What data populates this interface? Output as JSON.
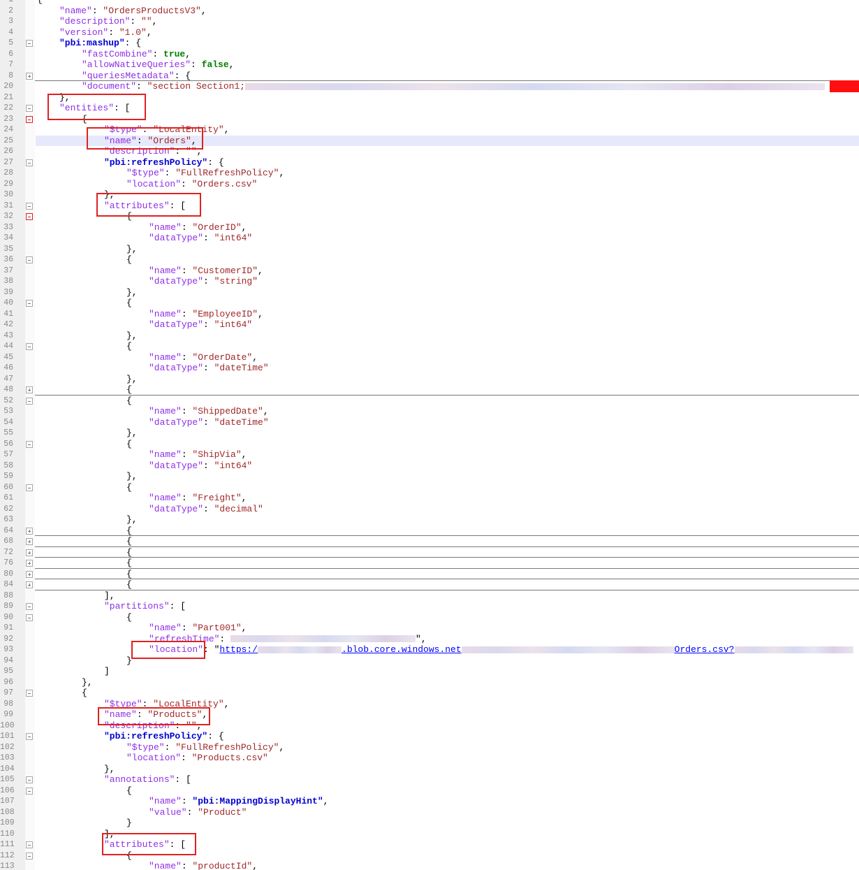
{
  "editor": {
    "lines": [
      {
        "n": "1",
        "d": 0,
        "t": [
          [
            "p",
            "{"
          ]
        ]
      },
      {
        "n": "2",
        "d": 1,
        "t": [
          [
            "k",
            "\"name\""
          ],
          [
            "p",
            ": "
          ],
          [
            "s",
            "\"OrdersProductsV3\""
          ],
          [
            "p",
            ","
          ]
        ]
      },
      {
        "n": "3",
        "d": 1,
        "t": [
          [
            "k",
            "\"description\""
          ],
          [
            "p",
            ": "
          ],
          [
            "s",
            "\"\""
          ],
          [
            "p",
            ","
          ]
        ]
      },
      {
        "n": "4",
        "d": 1,
        "t": [
          [
            "k",
            "\"version\""
          ],
          [
            "p",
            ": "
          ],
          [
            "s",
            "\"1.0\""
          ],
          [
            "p",
            ","
          ]
        ]
      },
      {
        "n": "5",
        "d": 1,
        "t": [
          [
            "b",
            "\"pbi:mashup\""
          ],
          [
            "p",
            ": {"
          ]
        ]
      },
      {
        "n": "6",
        "d": 2,
        "t": [
          [
            "k",
            "\"fastCombine\""
          ],
          [
            "p",
            ": "
          ],
          [
            "g",
            "true"
          ],
          [
            "p",
            ","
          ]
        ]
      },
      {
        "n": "7",
        "d": 2,
        "t": [
          [
            "k",
            "\"allowNativeQueries\""
          ],
          [
            "p",
            ": "
          ],
          [
            "g",
            "false"
          ],
          [
            "p",
            ","
          ]
        ]
      },
      {
        "n": "8",
        "d": 2,
        "t": [
          [
            "k",
            "\"queriesMetadata\""
          ],
          [
            "p",
            ": {"
          ]
        ]
      },
      {
        "n": "20",
        "d": 2,
        "t": [
          [
            "k",
            "\"document\""
          ],
          [
            "p",
            ": "
          ],
          [
            "s",
            "\"section Section1;"
          ],
          [
            "blur",
            "830"
          ]
        ]
      },
      {
        "n": "21",
        "d": 1,
        "t": [
          [
            "p",
            "},"
          ]
        ]
      },
      {
        "n": "22",
        "d": 1,
        "t": [
          [
            "k",
            "\"entities\""
          ],
          [
            "p",
            ": ["
          ]
        ]
      },
      {
        "n": "23",
        "d": 2,
        "t": [
          [
            "p",
            "{"
          ]
        ]
      },
      {
        "n": "24",
        "d": 3,
        "t": [
          [
            "k",
            "\"$type\""
          ],
          [
            "p",
            ": "
          ],
          [
            "s",
            "\"LocalEntity\""
          ],
          [
            "p",
            ","
          ]
        ]
      },
      {
        "n": "25",
        "d": 3,
        "t": [
          [
            "k",
            "\"name\""
          ],
          [
            "p",
            ": "
          ],
          [
            "s",
            "\"Orders\""
          ],
          [
            "p",
            ","
          ]
        ]
      },
      {
        "n": "26",
        "d": 3,
        "t": [
          [
            "k",
            "\"description\""
          ],
          [
            "p",
            ": "
          ],
          [
            "s",
            "\"\""
          ],
          [
            "p",
            ","
          ]
        ]
      },
      {
        "n": "27",
        "d": 3,
        "t": [
          [
            "b",
            "\"pbi:refreshPolicy\""
          ],
          [
            "p",
            ": {"
          ]
        ]
      },
      {
        "n": "28",
        "d": 4,
        "t": [
          [
            "k",
            "\"$type\""
          ],
          [
            "p",
            ": "
          ],
          [
            "s",
            "\"FullRefreshPolicy\""
          ],
          [
            "p",
            ","
          ]
        ]
      },
      {
        "n": "29",
        "d": 4,
        "t": [
          [
            "k",
            "\"location\""
          ],
          [
            "p",
            ": "
          ],
          [
            "s",
            "\"Orders.csv\""
          ]
        ]
      },
      {
        "n": "30",
        "d": 3,
        "t": [
          [
            "p",
            "},"
          ]
        ]
      },
      {
        "n": "31",
        "d": 3,
        "t": [
          [
            "k",
            "\"attributes\""
          ],
          [
            "p",
            ": ["
          ]
        ]
      },
      {
        "n": "32",
        "d": 4,
        "t": [
          [
            "p",
            "{"
          ]
        ]
      },
      {
        "n": "33",
        "d": 5,
        "t": [
          [
            "k",
            "\"name\""
          ],
          [
            "p",
            ": "
          ],
          [
            "s",
            "\"OrderID\""
          ],
          [
            "p",
            ","
          ]
        ]
      },
      {
        "n": "34",
        "d": 5,
        "t": [
          [
            "k",
            "\"dataType\""
          ],
          [
            "p",
            ": "
          ],
          [
            "s",
            "\"int64\""
          ]
        ]
      },
      {
        "n": "35",
        "d": 4,
        "t": [
          [
            "p",
            "},"
          ]
        ]
      },
      {
        "n": "36",
        "d": 4,
        "t": [
          [
            "p",
            "{"
          ]
        ]
      },
      {
        "n": "37",
        "d": 5,
        "t": [
          [
            "k",
            "\"name\""
          ],
          [
            "p",
            ": "
          ],
          [
            "s",
            "\"CustomerID\""
          ],
          [
            "p",
            ","
          ]
        ]
      },
      {
        "n": "38",
        "d": 5,
        "t": [
          [
            "k",
            "\"dataType\""
          ],
          [
            "p",
            ": "
          ],
          [
            "s",
            "\"string\""
          ]
        ]
      },
      {
        "n": "39",
        "d": 4,
        "t": [
          [
            "p",
            "},"
          ]
        ]
      },
      {
        "n": "40",
        "d": 4,
        "t": [
          [
            "p",
            "{"
          ]
        ]
      },
      {
        "n": "41",
        "d": 5,
        "t": [
          [
            "k",
            "\"name\""
          ],
          [
            "p",
            ": "
          ],
          [
            "s",
            "\"EmployeeID\""
          ],
          [
            "p",
            ","
          ]
        ]
      },
      {
        "n": "42",
        "d": 5,
        "t": [
          [
            "k",
            "\"dataType\""
          ],
          [
            "p",
            ": "
          ],
          [
            "s",
            "\"int64\""
          ]
        ]
      },
      {
        "n": "43",
        "d": 4,
        "t": [
          [
            "p",
            "},"
          ]
        ]
      },
      {
        "n": "44",
        "d": 4,
        "t": [
          [
            "p",
            "{"
          ]
        ]
      },
      {
        "n": "45",
        "d": 5,
        "t": [
          [
            "k",
            "\"name\""
          ],
          [
            "p",
            ": "
          ],
          [
            "s",
            "\"OrderDate\""
          ],
          [
            "p",
            ","
          ]
        ]
      },
      {
        "n": "46",
        "d": 5,
        "t": [
          [
            "k",
            "\"dataType\""
          ],
          [
            "p",
            ": "
          ],
          [
            "s",
            "\"dateTime\""
          ]
        ]
      },
      {
        "n": "47",
        "d": 4,
        "t": [
          [
            "p",
            "},"
          ]
        ]
      },
      {
        "n": "48",
        "d": 4,
        "t": [
          [
            "p",
            "{"
          ]
        ]
      },
      {
        "n": "52",
        "d": 4,
        "t": [
          [
            "p",
            "{"
          ]
        ]
      },
      {
        "n": "53",
        "d": 5,
        "t": [
          [
            "k",
            "\"name\""
          ],
          [
            "p",
            ": "
          ],
          [
            "s",
            "\"ShippedDate\""
          ],
          [
            "p",
            ","
          ]
        ]
      },
      {
        "n": "54",
        "d": 5,
        "t": [
          [
            "k",
            "\"dataType\""
          ],
          [
            "p",
            ": "
          ],
          [
            "s",
            "\"dateTime\""
          ]
        ]
      },
      {
        "n": "55",
        "d": 4,
        "t": [
          [
            "p",
            "},"
          ]
        ]
      },
      {
        "n": "56",
        "d": 4,
        "t": [
          [
            "p",
            "{"
          ]
        ]
      },
      {
        "n": "57",
        "d": 5,
        "t": [
          [
            "k",
            "\"name\""
          ],
          [
            "p",
            ": "
          ],
          [
            "s",
            "\"ShipVia\""
          ],
          [
            "p",
            ","
          ]
        ]
      },
      {
        "n": "58",
        "d": 5,
        "t": [
          [
            "k",
            "\"dataType\""
          ],
          [
            "p",
            ": "
          ],
          [
            "s",
            "\"int64\""
          ]
        ]
      },
      {
        "n": "59",
        "d": 4,
        "t": [
          [
            "p",
            "},"
          ]
        ]
      },
      {
        "n": "60",
        "d": 4,
        "t": [
          [
            "p",
            "{"
          ]
        ]
      },
      {
        "n": "61",
        "d": 5,
        "t": [
          [
            "k",
            "\"name\""
          ],
          [
            "p",
            ": "
          ],
          [
            "s",
            "\"Freight\""
          ],
          [
            "p",
            ","
          ]
        ]
      },
      {
        "n": "62",
        "d": 5,
        "t": [
          [
            "k",
            "\"dataType\""
          ],
          [
            "p",
            ": "
          ],
          [
            "s",
            "\"decimal\""
          ]
        ]
      },
      {
        "n": "63",
        "d": 4,
        "t": [
          [
            "p",
            "},"
          ]
        ]
      },
      {
        "n": "64",
        "d": 4,
        "t": [
          [
            "p",
            "{"
          ]
        ]
      },
      {
        "n": "68",
        "d": 4,
        "t": [
          [
            "p",
            "{"
          ]
        ]
      },
      {
        "n": "72",
        "d": 4,
        "t": [
          [
            "p",
            "{"
          ]
        ]
      },
      {
        "n": "76",
        "d": 4,
        "t": [
          [
            "p",
            "{"
          ]
        ]
      },
      {
        "n": "80",
        "d": 4,
        "t": [
          [
            "p",
            "{"
          ]
        ]
      },
      {
        "n": "84",
        "d": 4,
        "t": [
          [
            "p",
            "{"
          ]
        ]
      },
      {
        "n": "88",
        "d": 3,
        "t": [
          [
            "p",
            "],"
          ]
        ]
      },
      {
        "n": "89",
        "d": 3,
        "t": [
          [
            "k",
            "\"partitions\""
          ],
          [
            "p",
            ": ["
          ]
        ]
      },
      {
        "n": "90",
        "d": 4,
        "t": [
          [
            "p",
            "{"
          ]
        ]
      },
      {
        "n": "91",
        "d": 5,
        "t": [
          [
            "k",
            "\"name\""
          ],
          [
            "p",
            ": "
          ],
          [
            "s",
            "\"Part001\""
          ],
          [
            "p",
            ","
          ]
        ]
      },
      {
        "n": "92",
        "d": 5,
        "t": [
          [
            "k",
            "\"refreshTime\""
          ],
          [
            "p",
            ": "
          ],
          [
            "blur",
            "265"
          ],
          [
            "p",
            "\","
          ]
        ]
      },
      {
        "n": "93",
        "d": 5,
        "t": [
          [
            "k",
            "\"location\""
          ],
          [
            "p",
            ": \""
          ],
          [
            "u",
            "https:/"
          ],
          [
            "blur",
            "120"
          ],
          [
            "u",
            ".blob.core.windows.net"
          ],
          [
            "blur",
            "305"
          ],
          [
            "u",
            "Orders.csv?"
          ],
          [
            "blur",
            "170"
          ]
        ]
      },
      {
        "n": "94",
        "d": 4,
        "t": [
          [
            "p",
            "}"
          ]
        ]
      },
      {
        "n": "95",
        "d": 3,
        "t": [
          [
            "p",
            "]"
          ]
        ]
      },
      {
        "n": "96",
        "d": 2,
        "t": [
          [
            "p",
            "},"
          ]
        ]
      },
      {
        "n": "97",
        "d": 2,
        "t": [
          [
            "p",
            "{"
          ]
        ]
      },
      {
        "n": "98",
        "d": 3,
        "t": [
          [
            "k",
            "\"$type\""
          ],
          [
            "p",
            ": "
          ],
          [
            "s",
            "\"LocalEntity\""
          ],
          [
            "p",
            ","
          ]
        ]
      },
      {
        "n": "99",
        "d": 3,
        "t": [
          [
            "k",
            "\"name\""
          ],
          [
            "p",
            ": "
          ],
          [
            "s",
            "\"Products\""
          ],
          [
            "p",
            ","
          ]
        ]
      },
      {
        "n": "100",
        "d": 3,
        "t": [
          [
            "k",
            "\"description\""
          ],
          [
            "p",
            ": "
          ],
          [
            "s",
            "\"\""
          ],
          [
            "p",
            ","
          ]
        ]
      },
      {
        "n": "101",
        "d": 3,
        "t": [
          [
            "b",
            "\"pbi:refreshPolicy\""
          ],
          [
            "p",
            ": {"
          ]
        ]
      },
      {
        "n": "102",
        "d": 4,
        "t": [
          [
            "k",
            "\"$type\""
          ],
          [
            "p",
            ": "
          ],
          [
            "s",
            "\"FullRefreshPolicy\""
          ],
          [
            "p",
            ","
          ]
        ]
      },
      {
        "n": "103",
        "d": 4,
        "t": [
          [
            "k",
            "\"location\""
          ],
          [
            "p",
            ": "
          ],
          [
            "s",
            "\"Products.csv\""
          ]
        ]
      },
      {
        "n": "104",
        "d": 3,
        "t": [
          [
            "p",
            "},"
          ]
        ]
      },
      {
        "n": "105",
        "d": 3,
        "t": [
          [
            "k",
            "\"annotations\""
          ],
          [
            "p",
            ": ["
          ]
        ]
      },
      {
        "n": "106",
        "d": 4,
        "t": [
          [
            "p",
            "{"
          ]
        ]
      },
      {
        "n": "107",
        "d": 5,
        "t": [
          [
            "k",
            "\"name\""
          ],
          [
            "p",
            ": "
          ],
          [
            "b",
            "\"pbi:MappingDisplayHint\""
          ],
          [
            "p",
            ","
          ]
        ]
      },
      {
        "n": "108",
        "d": 5,
        "t": [
          [
            "k",
            "\"value\""
          ],
          [
            "p",
            ": "
          ],
          [
            "s",
            "\"Product\""
          ]
        ]
      },
      {
        "n": "109",
        "d": 4,
        "t": [
          [
            "p",
            "}"
          ]
        ]
      },
      {
        "n": "110",
        "d": 3,
        "t": [
          [
            "p",
            "],"
          ]
        ]
      },
      {
        "n": "111",
        "d": 3,
        "t": [
          [
            "k",
            "\"attributes\""
          ],
          [
            "p",
            ": ["
          ]
        ]
      },
      {
        "n": "112",
        "d": 4,
        "t": [
          [
            "p",
            "{"
          ]
        ]
      },
      {
        "n": "113",
        "d": 5,
        "t": [
          [
            "k",
            "\"name\""
          ],
          [
            "p",
            ": "
          ],
          [
            "s",
            "\"productId\""
          ],
          [
            "p",
            ","
          ]
        ]
      }
    ]
  },
  "colors": {
    "key": "#8f2fe6",
    "string": "#a0282a",
    "bold_key": "#0000d0",
    "boolean": "#008000",
    "link": "#0000ff",
    "highlight_box": "#e02020",
    "current_line": "#e6e8fb"
  }
}
